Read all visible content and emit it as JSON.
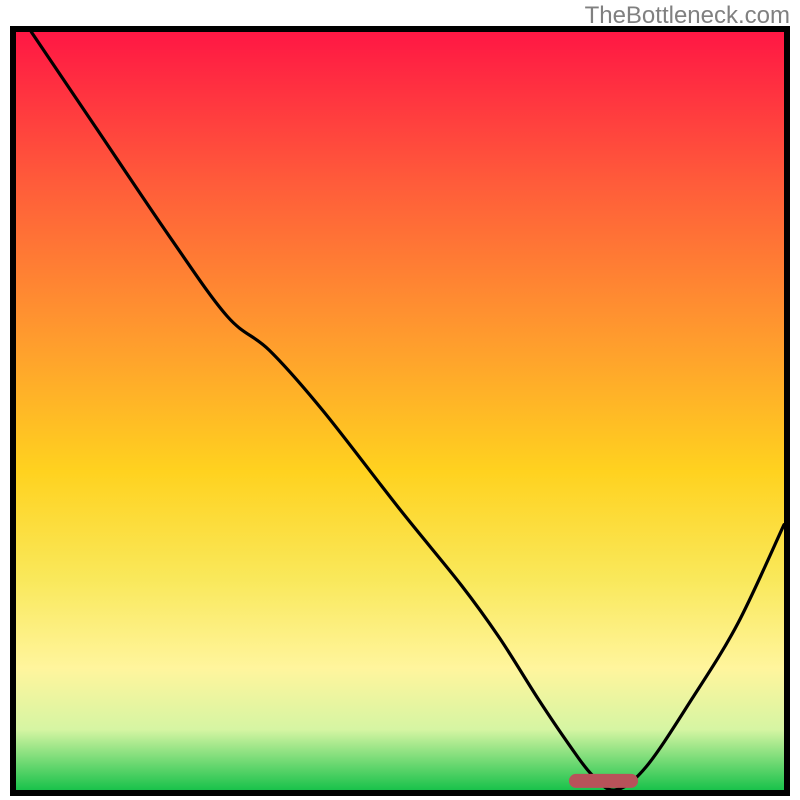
{
  "watermark": "TheBottleneck.com",
  "colors": {
    "border": "#000000",
    "line": "#000000",
    "marker_fill": "#b8525a",
    "grad_top": "#ff1744",
    "grad_mid1": "#ff5c3a",
    "grad_mid2": "#ff9a2e",
    "grad_mid3": "#ffd21f",
    "grad_mid4": "#f9e85a",
    "grad_low1": "#fff59d",
    "grad_low2": "#d6f5a3",
    "grad_bot": "#19c24b"
  },
  "chart_data": {
    "type": "line",
    "title": "",
    "xlabel": "",
    "ylabel": "",
    "xlim": [
      0,
      100
    ],
    "ylim": [
      0,
      100
    ],
    "x": [
      2,
      10,
      20,
      27.5,
      33,
      40,
      50,
      58,
      63,
      68,
      72,
      75,
      78,
      82,
      88,
      94,
      100
    ],
    "values": [
      100,
      88,
      73,
      62.5,
      58,
      50,
      37,
      27,
      20,
      12,
      6,
      2,
      0,
      3,
      12,
      22,
      35
    ],
    "marker": {
      "x0": 72,
      "x1": 81,
      "y": 1.2,
      "rx": 1.3
    }
  }
}
